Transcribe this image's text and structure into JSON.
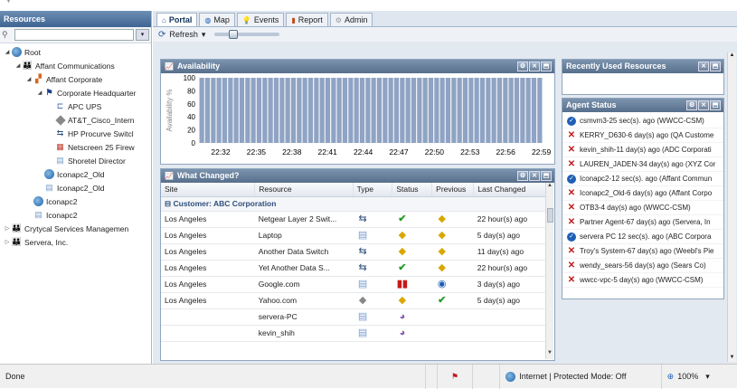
{
  "sidebar": {
    "title": "Resources",
    "tree": [
      {
        "label": "Root",
        "level": 0,
        "icon": "globe",
        "expander": "expanded"
      },
      {
        "label": "Affant Communications",
        "level": 1,
        "icon": "family",
        "expander": "expanded"
      },
      {
        "label": "Affant Corporate",
        "level": 2,
        "icon": "building",
        "expander": "expanded"
      },
      {
        "label": "Corporate Headquarter",
        "level": 3,
        "icon": "flag",
        "expander": "expanded"
      },
      {
        "label": "APC UPS",
        "level": 4,
        "icon": "ups",
        "expander": ""
      },
      {
        "label": "AT&T_Cisco_Intern",
        "level": 4,
        "icon": "diamond",
        "expander": ""
      },
      {
        "label": "HP Procurve Switcl",
        "level": 4,
        "icon": "switch",
        "expander": ""
      },
      {
        "label": "Netscreen 25 Firew",
        "level": 4,
        "icon": "firewall",
        "expander": ""
      },
      {
        "label": "Shoretel Director",
        "level": 4,
        "icon": "server",
        "expander": ""
      },
      {
        "label": "Iconapc2_Old",
        "level": 3,
        "icon": "globe",
        "expander": ""
      },
      {
        "label": "Iconapc2_Old",
        "level": 3,
        "icon": "server",
        "expander": ""
      },
      {
        "label": "Iconapc2",
        "level": 2,
        "icon": "globe",
        "expander": ""
      },
      {
        "label": "Iconapc2",
        "level": 2,
        "icon": "server",
        "expander": ""
      },
      {
        "label": "Crytycal Services Managemen",
        "level": 0,
        "icon": "family",
        "expander": "collapsed"
      },
      {
        "label": "Servera, Inc.",
        "level": 0,
        "icon": "family",
        "expander": "collapsed"
      }
    ]
  },
  "tabs": [
    {
      "label": "Portal",
      "icon": "home",
      "active": true
    },
    {
      "label": "Map",
      "icon": "globe",
      "active": false
    },
    {
      "label": "Events",
      "icon": "bulb",
      "active": false
    },
    {
      "label": "Report",
      "icon": "bar-chart",
      "active": false
    },
    {
      "label": "Admin",
      "icon": "gear",
      "active": false
    }
  ],
  "toolbar": {
    "refresh_label": "Refresh",
    "refresh_arrow": "▾",
    "zoom_level": 0.25
  },
  "availability": {
    "title": "Availability",
    "chart_data": {
      "type": "bar",
      "ylabel": "Availability %",
      "yticks": [
        "100",
        "80",
        "60",
        "40",
        "20",
        "0"
      ],
      "xticks": [
        "22:32",
        "22:35",
        "22:38",
        "22:41",
        "22:44",
        "22:47",
        "22:50",
        "22:53",
        "22:56",
        "22:59"
      ],
      "bar_count": 60,
      "value": 100,
      "ylim": [
        0,
        100
      ],
      "bar_color": "#8fa3c4"
    }
  },
  "what_changed": {
    "title": "What Changed?",
    "columns": [
      "Site",
      "Resource",
      "Type",
      "Status",
      "Previous",
      "Last Changed"
    ],
    "group": "Customer: ABC Corporation",
    "rows": [
      {
        "site": "Los Angeles",
        "resource": "Netgear Layer 2 Swit...",
        "type": "switch",
        "status": "ok",
        "previous": "warn",
        "changed": "22 hour(s) ago"
      },
      {
        "site": "Los Angeles",
        "resource": "Laptop",
        "type": "server",
        "status": "warn",
        "previous": "warn",
        "changed": "5 day(s) ago"
      },
      {
        "site": "Los Angeles",
        "resource": "Another Data Switch",
        "type": "switch",
        "status": "warn",
        "previous": "warn",
        "changed": "11 day(s) ago"
      },
      {
        "site": "Los Angeles",
        "resource": "Yet Another Data S...",
        "type": "switch",
        "status": "ok",
        "previous": "warn",
        "changed": "22 hour(s) ago"
      },
      {
        "site": "Los Angeles",
        "resource": "Google.com",
        "type": "server",
        "status": "crit",
        "previous": "info",
        "changed": "3 day(s) ago"
      },
      {
        "site": "Los Angeles",
        "resource": "Yahoo.com",
        "type": "diamond",
        "status": "warn",
        "previous": "ok",
        "changed": "5 day(s) ago"
      },
      {
        "site": "",
        "resource": "servera-PC",
        "type": "server",
        "status": "unk",
        "previous": "",
        "changed": ""
      },
      {
        "site": "",
        "resource": "kevin_shih",
        "type": "server",
        "status": "unk",
        "previous": "",
        "changed": ""
      }
    ]
  },
  "recent": {
    "title": "Recently Used Resources"
  },
  "agents": {
    "title": "Agent Status",
    "items": [
      {
        "text": "csmvm3-25 sec(s). ago (WWCC-CSM)",
        "status": "ok"
      },
      {
        "text": "KERRY_D630-6 day(s) ago (QA Custome",
        "status": "down"
      },
      {
        "text": "kevin_shih-11 day(s) ago (ADC Corporati",
        "status": "down"
      },
      {
        "text": "LAUREN_JADEN-34 day(s) ago (XYZ Cor",
        "status": "down"
      },
      {
        "text": "Iconapc2-12 sec(s). ago (Affant Commun",
        "status": "ok"
      },
      {
        "text": "Iconapc2_Old-6 day(s) ago (Affant Corpo",
        "status": "down"
      },
      {
        "text": "OTB3-4 day(s) ago (WWCC-CSM)",
        "status": "down"
      },
      {
        "text": "Partner Agent-67 day(s) ago (Servera, In",
        "status": "down"
      },
      {
        "text": "servera PC 12 sec(s). ago (ABC Corpora",
        "status": "ok"
      },
      {
        "text": "Troy's System-67 day(s) ago (Weebl's Pie",
        "status": "down"
      },
      {
        "text": "wendy_sears-56 day(s) ago (Sears Co)",
        "status": "down"
      },
      {
        "text": "wwcc-vpc-5 day(s) ago (WWCC-CSM)",
        "status": "down"
      }
    ]
  },
  "statusbar": {
    "done": "Done",
    "zone": "Internet | Protected Mode: Off",
    "zoom": "100%",
    "zoom_arrow": "▾"
  }
}
